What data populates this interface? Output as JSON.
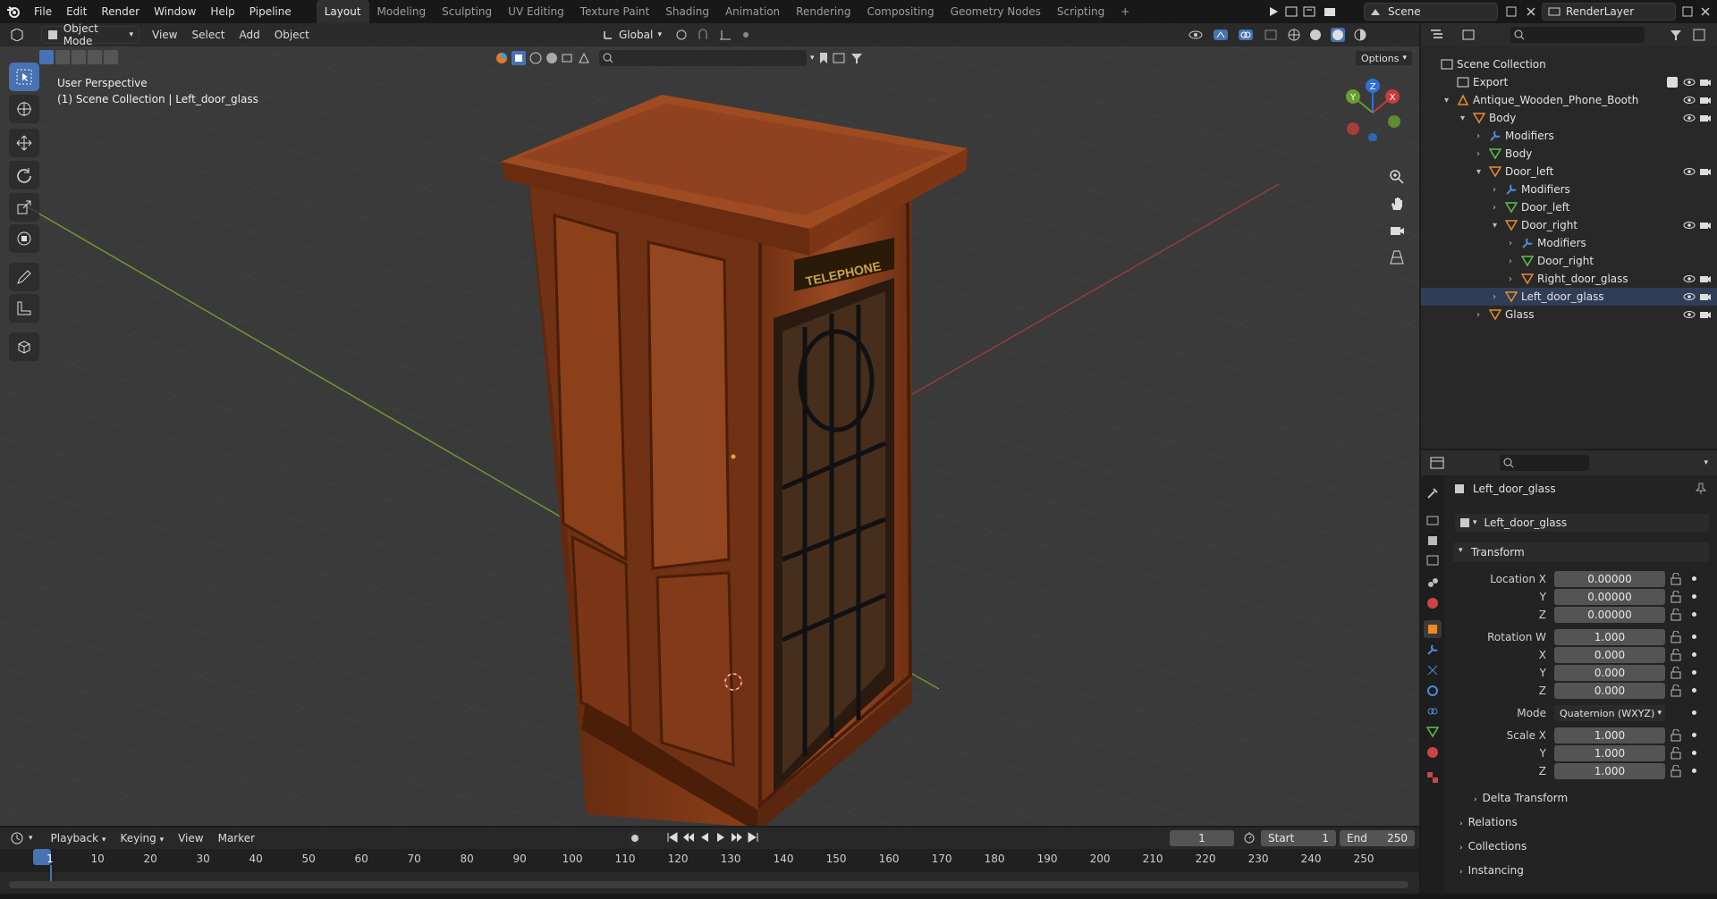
{
  "topbar": {
    "menus": [
      "File",
      "Edit",
      "Render",
      "Window",
      "Help",
      "Pipeline"
    ],
    "workspaces": [
      "Layout",
      "Modeling",
      "Sculpting",
      "UV Editing",
      "Texture Paint",
      "Shading",
      "Animation",
      "Rendering",
      "Compositing",
      "Geometry Nodes",
      "Scripting"
    ],
    "add_tab": "+",
    "scene_name": "Scene",
    "render_layer": "RenderLayer"
  },
  "viewport": {
    "mode": "Object Mode",
    "menus": [
      "View",
      "Select",
      "Add",
      "Object"
    ],
    "orientation": "Global",
    "options_label": "Options",
    "perspective_label": "User Perspective",
    "collection_label": "(1) Scene Collection | Left_door_glass",
    "booth_sign": "TELEPHONE",
    "gizmo_axes": [
      "X",
      "Y",
      "Z"
    ]
  },
  "outliner": {
    "items": [
      {
        "label": "Scene Collection",
        "indent": 0
      },
      {
        "label": "Export",
        "indent": 1
      },
      {
        "label": "Antique_Wooden_Phone_Booth",
        "indent": 1
      },
      {
        "label": "Body",
        "indent": 2
      },
      {
        "label": "Modifiers",
        "indent": 3
      },
      {
        "label": "Body",
        "indent": 3
      },
      {
        "label": "Door_left",
        "indent": 3
      },
      {
        "label": "Modifiers",
        "indent": 4
      },
      {
        "label": "Door_left",
        "indent": 4
      },
      {
        "label": "Door_right",
        "indent": 4
      },
      {
        "label": "Modifiers",
        "indent": 5
      },
      {
        "label": "Door_right",
        "indent": 5
      },
      {
        "label": "Right_door_glass",
        "indent": 5
      },
      {
        "label": "Left_door_glass",
        "indent": 4
      },
      {
        "label": "Glass",
        "indent": 3
      }
    ]
  },
  "properties": {
    "object_name": "Left_door_glass",
    "datablock_name": "Left_door_glass",
    "transform_header": "Transform",
    "location_label": "Location X",
    "location": [
      "0.00000",
      "0.00000",
      "0.00000"
    ],
    "rotation_label": "Rotation W",
    "rotation": [
      "1.000",
      "0.000",
      "0.000",
      "0.000"
    ],
    "mode_label": "Mode",
    "mode_value": "Quaternion (WXYZ)",
    "scale_label": "Scale X",
    "scale": [
      "1.000",
      "1.000",
      "1.000"
    ],
    "axis_y": "Y",
    "axis_z": "Z",
    "axis_x": "X",
    "delta_transform": "Delta Transform",
    "relations": "Relations",
    "collections": "Collections",
    "instancing": "Instancing"
  },
  "timeline": {
    "menus": [
      "Playback",
      "Keying",
      "View",
      "Marker"
    ],
    "current_frame": "1",
    "start_label": "Start",
    "start_value": "1",
    "end_label": "End",
    "end_value": "250",
    "ruler": [
      "1",
      "10",
      "20",
      "30",
      "40",
      "50",
      "60",
      "70",
      "80",
      "90",
      "100",
      "110",
      "120",
      "130",
      "140",
      "150",
      "160",
      "170",
      "180",
      "190",
      "200",
      "210",
      "220",
      "230",
      "240",
      "250"
    ]
  },
  "colors": {
    "accent": "#4772b3",
    "wood": "#8a3f1c",
    "selected": "#f0a030"
  }
}
